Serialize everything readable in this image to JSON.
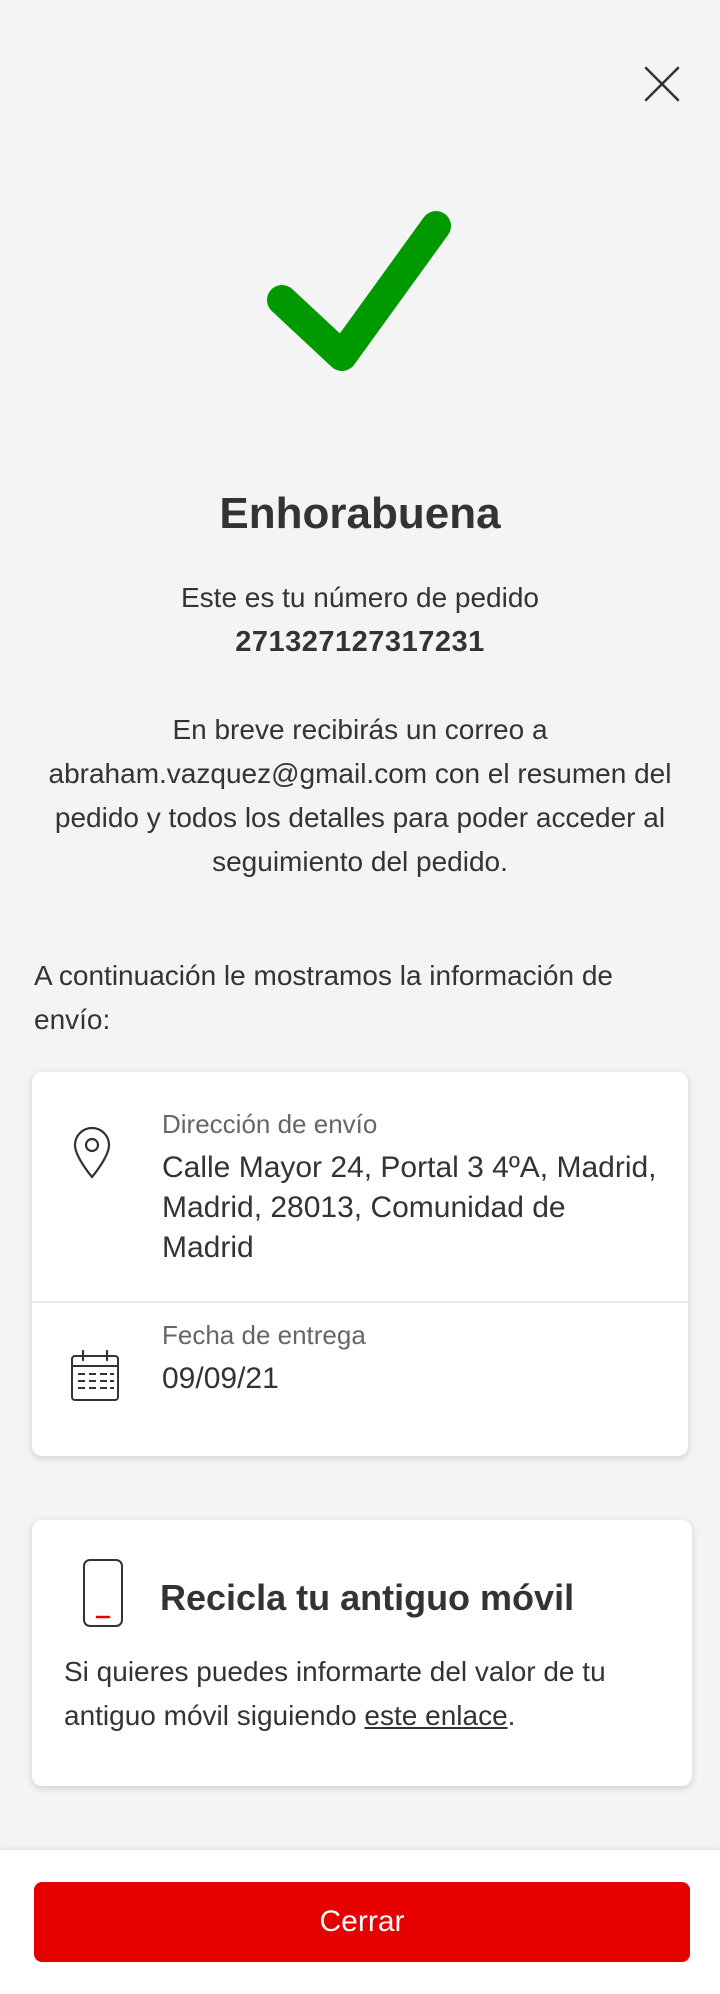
{
  "header": {
    "close_icon": "close-icon"
  },
  "success": {
    "icon": "check-icon",
    "icon_color": "#009900",
    "title": "Enhorabuena",
    "order_label": "Este es tu número de pedido",
    "order_number": "271327127317231",
    "email_message": "En breve recibirás un correo a abraham.vazquez@gmail.com con el resumen del pedido y todos los detalles para poder acceder al seguimiento del pedido."
  },
  "shipping": {
    "intro": "A continuación le mostramos la información de envío:",
    "address_icon": "location-pin-icon",
    "address_label": "Dirección de envío",
    "address_value": "Calle Mayor 24, Portal 3 4ºA, Madrid, Madrid, 28013, Comunidad de Madrid",
    "date_icon": "calendar-icon",
    "date_label": "Fecha de entrega",
    "date_value": "09/09/21"
  },
  "recycle": {
    "icon": "mobile-phone-icon",
    "title": "Recicla tu antiguo móvil",
    "text_before_link": "Si quieres puedes informarte del valor de tu antiguo móvil siguiendo ",
    "link_text": "este enlace",
    "text_after_link": "."
  },
  "footer": {
    "button_label": "Cerrar",
    "button_color": "#e60000"
  }
}
